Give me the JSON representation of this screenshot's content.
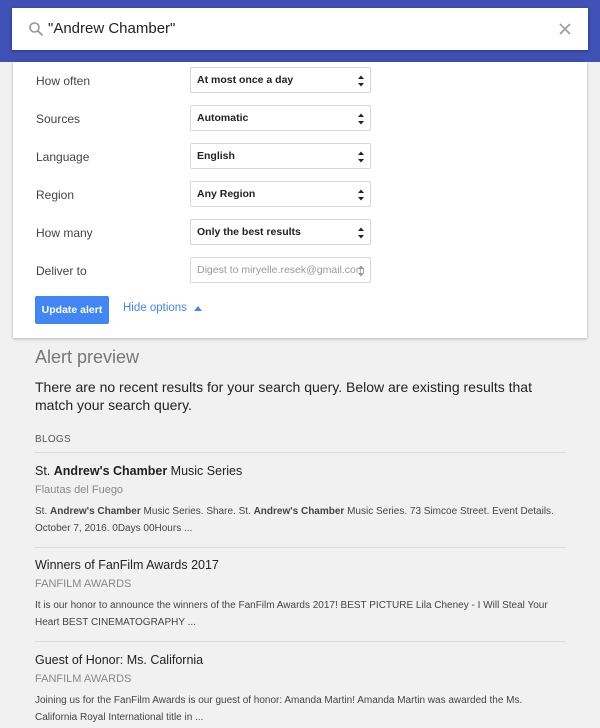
{
  "search": {
    "query": "\"Andrew Chamber\""
  },
  "options": [
    {
      "label": "How often",
      "value": "At most once a day"
    },
    {
      "label": "Sources",
      "value": "Automatic"
    },
    {
      "label": "Language",
      "value": "English"
    },
    {
      "label": "Region",
      "value": "Any Region"
    },
    {
      "label": "How many",
      "value": "Only the best results"
    },
    {
      "label": "Deliver to",
      "value": "Digest to miryelle.resek@gmail.com"
    }
  ],
  "actions": {
    "update_label": "Update alert",
    "hide_options_label": "Hide options"
  },
  "preview": {
    "title": "Alert preview",
    "message": "There are no recent results for your search query. Below are existing results that match your search query.",
    "section_label": "BLOGS",
    "results": [
      {
        "title_parts": [
          "St. ",
          "Andrew's Chamber",
          " Music Series"
        ],
        "source": "Flautas del Fuego",
        "snippet_parts": [
          "St. ",
          "Andrew's Chamber",
          " Music Series. Share. St. ",
          "Andrew's Chamber",
          " Music Series. 73 Simcoe Street. Event Details. October 7, 2016. 0Days 00Hours ..."
        ]
      },
      {
        "title": "Winners of FanFilm Awards 2017",
        "source": "FANFILM AWARDS",
        "snippet": "It is our honor to announce the winners of the FanFilm Awards 2017! BEST PICTURE Lila Cheney - I Will Steal Your Heart BEST CINEMATOGRAPHY ..."
      },
      {
        "title": "Guest of Honor: Ms. California",
        "source": "FANFILM AWARDS",
        "snippet": "Joining us for the FanFilm Awards is our guest of honor: Amanda Martin! Amanda Martin was awarded the Ms. California Royal International title in ..."
      }
    ]
  },
  "colors": {
    "header_bg": "#3f51b5",
    "accent": "#4285f4"
  }
}
